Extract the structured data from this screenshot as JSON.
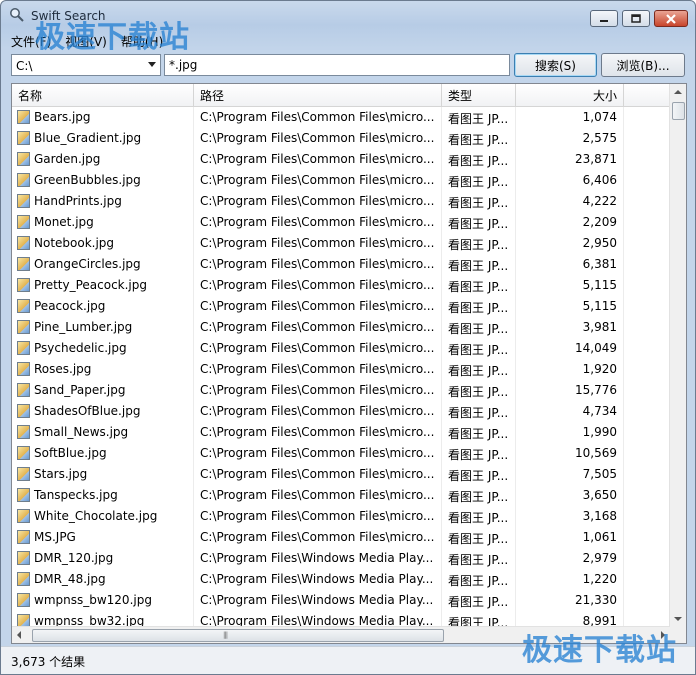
{
  "window": {
    "title": "Swift Search",
    "menu": [
      "文件(F)",
      "视图(V)",
      "帮助(H)"
    ]
  },
  "toolbar": {
    "drive_value": "C:\\",
    "query_value": "*.jpg",
    "search_label": "搜索(S)",
    "browse_label": "浏览(B)..."
  },
  "columns": [
    "名称",
    "路径",
    "类型",
    "大小"
  ],
  "files": [
    {
      "name": "Bears.jpg",
      "path": "C:\\Program Files\\Common Files\\micro...",
      "type": "看图王 JP...",
      "size": "1,074"
    },
    {
      "name": "Blue_Gradient.jpg",
      "path": "C:\\Program Files\\Common Files\\micro...",
      "type": "看图王 JP...",
      "size": "2,575"
    },
    {
      "name": "Garden.jpg",
      "path": "C:\\Program Files\\Common Files\\micro...",
      "type": "看图王 JP...",
      "size": "23,871"
    },
    {
      "name": "GreenBubbles.jpg",
      "path": "C:\\Program Files\\Common Files\\micro...",
      "type": "看图王 JP...",
      "size": "6,406"
    },
    {
      "name": "HandPrints.jpg",
      "path": "C:\\Program Files\\Common Files\\micro...",
      "type": "看图王 JP...",
      "size": "4,222"
    },
    {
      "name": "Monet.jpg",
      "path": "C:\\Program Files\\Common Files\\micro...",
      "type": "看图王 JP...",
      "size": "2,209"
    },
    {
      "name": "Notebook.jpg",
      "path": "C:\\Program Files\\Common Files\\micro...",
      "type": "看图王 JP...",
      "size": "2,950"
    },
    {
      "name": "OrangeCircles.jpg",
      "path": "C:\\Program Files\\Common Files\\micro...",
      "type": "看图王 JP...",
      "size": "6,381"
    },
    {
      "name": "Pretty_Peacock.jpg",
      "path": "C:\\Program Files\\Common Files\\micro...",
      "type": "看图王 JP...",
      "size": "5,115"
    },
    {
      "name": "Peacock.jpg",
      "path": "C:\\Program Files\\Common Files\\micro...",
      "type": "看图王 JP...",
      "size": "5,115"
    },
    {
      "name": "Pine_Lumber.jpg",
      "path": "C:\\Program Files\\Common Files\\micro...",
      "type": "看图王 JP...",
      "size": "3,981"
    },
    {
      "name": "Psychedelic.jpg",
      "path": "C:\\Program Files\\Common Files\\micro...",
      "type": "看图王 JP...",
      "size": "14,049"
    },
    {
      "name": "Roses.jpg",
      "path": "C:\\Program Files\\Common Files\\micro...",
      "type": "看图王 JP...",
      "size": "1,920"
    },
    {
      "name": "Sand_Paper.jpg",
      "path": "C:\\Program Files\\Common Files\\micro...",
      "type": "看图王 JP...",
      "size": "15,776"
    },
    {
      "name": "ShadesOfBlue.jpg",
      "path": "C:\\Program Files\\Common Files\\micro...",
      "type": "看图王 JP...",
      "size": "4,734"
    },
    {
      "name": "Small_News.jpg",
      "path": "C:\\Program Files\\Common Files\\micro...",
      "type": "看图王 JP...",
      "size": "1,990"
    },
    {
      "name": "SoftBlue.jpg",
      "path": "C:\\Program Files\\Common Files\\micro...",
      "type": "看图王 JP...",
      "size": "10,569"
    },
    {
      "name": "Stars.jpg",
      "path": "C:\\Program Files\\Common Files\\micro...",
      "type": "看图王 JP...",
      "size": "7,505"
    },
    {
      "name": "Tanspecks.jpg",
      "path": "C:\\Program Files\\Common Files\\micro...",
      "type": "看图王 JP...",
      "size": "3,650"
    },
    {
      "name": "White_Chocolate.jpg",
      "path": "C:\\Program Files\\Common Files\\micro...",
      "type": "看图王 JP...",
      "size": "3,168"
    },
    {
      "name": "MS.JPG",
      "path": "C:\\Program Files\\Common Files\\micro...",
      "type": "看图王 JP...",
      "size": "1,061"
    },
    {
      "name": "DMR_120.jpg",
      "path": "C:\\Program Files\\Windows Media Play...",
      "type": "看图王 JP...",
      "size": "2,979"
    },
    {
      "name": "DMR_48.jpg",
      "path": "C:\\Program Files\\Windows Media Play...",
      "type": "看图王 JP...",
      "size": "1,220"
    },
    {
      "name": "wmpnss_bw120.jpg",
      "path": "C:\\Program Files\\Windows Media Play...",
      "type": "看图王 JP...",
      "size": "21,330"
    },
    {
      "name": "wmpnss_bw32.jpg",
      "path": "C:\\Program Files\\Windows Media Play...",
      "type": "看图王 JP...",
      "size": "8,991"
    }
  ],
  "status": {
    "result_text": "3,673 个结果"
  },
  "watermark": {
    "text": "极速下载站"
  },
  "icons": {
    "file": "jpg-file-icon",
    "app": "search-app-icon"
  },
  "colors": {
    "title_bar": "#c9d9ec",
    "close_button": "#c8452c",
    "watermark": "#2882d2"
  }
}
